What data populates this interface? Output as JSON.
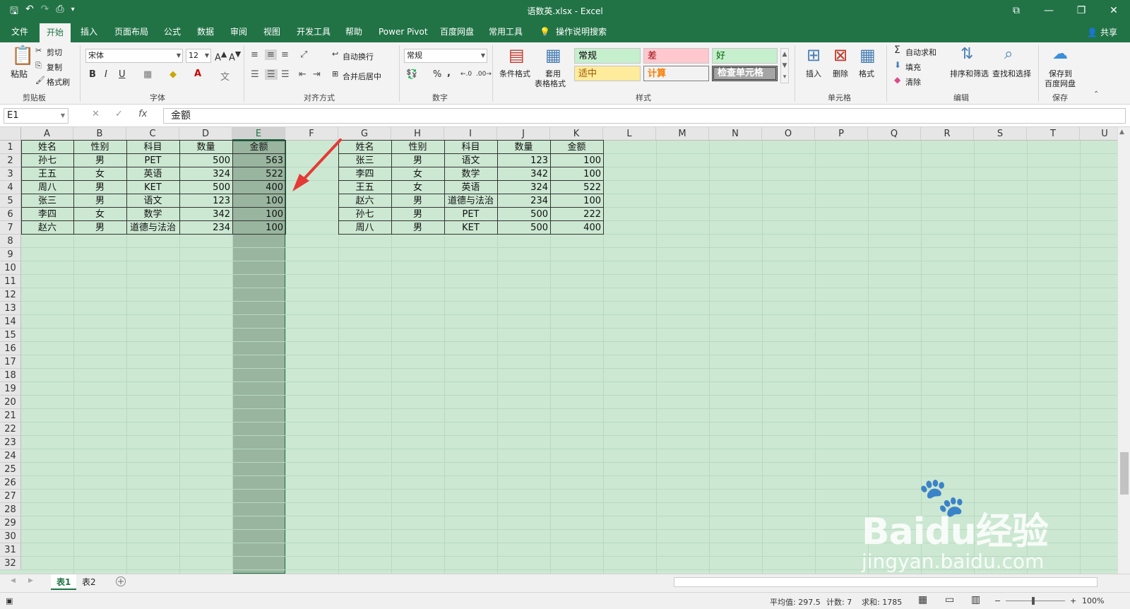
{
  "window": {
    "title": "语数英.xlsx - Excel"
  },
  "ribbon_tabs": [
    "文件",
    "开始",
    "插入",
    "页面布局",
    "公式",
    "数据",
    "审阅",
    "视图",
    "开发工具",
    "帮助",
    "Power Pivot",
    "百度网盘",
    "常用工具",
    "操作说明搜索"
  ],
  "share": "共享",
  "clipboard": {
    "paste": "粘贴",
    "cut": "剪切",
    "copy": "复制",
    "format_painter": "格式刷",
    "group": "剪贴板"
  },
  "font": {
    "name": "宋体",
    "size": "12",
    "group": "字体",
    "bold": "B",
    "italic": "I",
    "underline": "U"
  },
  "alignment": {
    "wrap": "自动换行",
    "merge": "合并后居中",
    "group": "对齐方式"
  },
  "number": {
    "format": "常规",
    "group": "数字",
    "percent": "%",
    "comma": ","
  },
  "styles": {
    "conditional": "条件格式",
    "table_format_1": "套用",
    "table_format_2": "表格格式",
    "group": "样式",
    "normal": "常规",
    "bad": "差",
    "good": "好",
    "neutral": "适中",
    "calc": "计算",
    "check": "检查单元格"
  },
  "cells": {
    "insert": "插入",
    "delete": "删除",
    "format": "格式",
    "group": "单元格"
  },
  "editing": {
    "autosum": "自动求和",
    "fill": "填充",
    "clear": "清除",
    "sort": "排序和筛选",
    "find": "查找和选择",
    "group": "编辑"
  },
  "save_group": {
    "label_1": "保存到",
    "label_2": "百度网盘",
    "group": "保存"
  },
  "formula_bar": {
    "name_box": "E1",
    "fx": "fx",
    "content": "金额"
  },
  "columns": [
    "A",
    "B",
    "C",
    "D",
    "E",
    "F",
    "G",
    "H",
    "I",
    "J",
    "K",
    "L",
    "M",
    "N",
    "O",
    "P",
    "Q",
    "R",
    "S",
    "T",
    "U"
  ],
  "rows": [
    "1",
    "2",
    "3",
    "4",
    "5",
    "6",
    "7",
    "8",
    "9",
    "10",
    "11",
    "12",
    "13",
    "14",
    "15",
    "16",
    "17",
    "18",
    "19",
    "20",
    "21",
    "22",
    "23",
    "24",
    "25",
    "26",
    "27",
    "28",
    "29",
    "30",
    "31",
    "32"
  ],
  "table1": {
    "header": [
      "姓名",
      "性别",
      "科目",
      "数量",
      "金额"
    ],
    "rows": [
      [
        "孙七",
        "男",
        "PET",
        "500",
        "563"
      ],
      [
        "王五",
        "女",
        "英语",
        "324",
        "522"
      ],
      [
        "周八",
        "男",
        "KET",
        "500",
        "400"
      ],
      [
        "张三",
        "男",
        "语文",
        "123",
        "100"
      ],
      [
        "李四",
        "女",
        "数学",
        "342",
        "100"
      ],
      [
        "赵六",
        "男",
        "道德与法治",
        "234",
        "100"
      ]
    ]
  },
  "table2": {
    "header": [
      "姓名",
      "性别",
      "科目",
      "数量",
      "金额"
    ],
    "rows": [
      [
        "张三",
        "男",
        "语文",
        "123",
        "100"
      ],
      [
        "李四",
        "女",
        "数学",
        "342",
        "100"
      ],
      [
        "王五",
        "女",
        "英语",
        "324",
        "522"
      ],
      [
        "赵六",
        "男",
        "道德与法治",
        "234",
        "100"
      ],
      [
        "孙七",
        "男",
        "PET",
        "500",
        "222"
      ],
      [
        "周八",
        "男",
        "KET",
        "500",
        "400"
      ]
    ]
  },
  "sheets": [
    "表1",
    "表2"
  ],
  "status": {
    "average": "平均值: 297.5",
    "count": "计数: 7",
    "sum": "求和: 1785",
    "zoom": "100%"
  },
  "watermark": {
    "brand": "Baidu经验",
    "url": "jingyan.baidu.com"
  },
  "colors": {
    "accent": "#217346",
    "grid_bg": "#cce8d2",
    "arrow": "#e53935"
  }
}
